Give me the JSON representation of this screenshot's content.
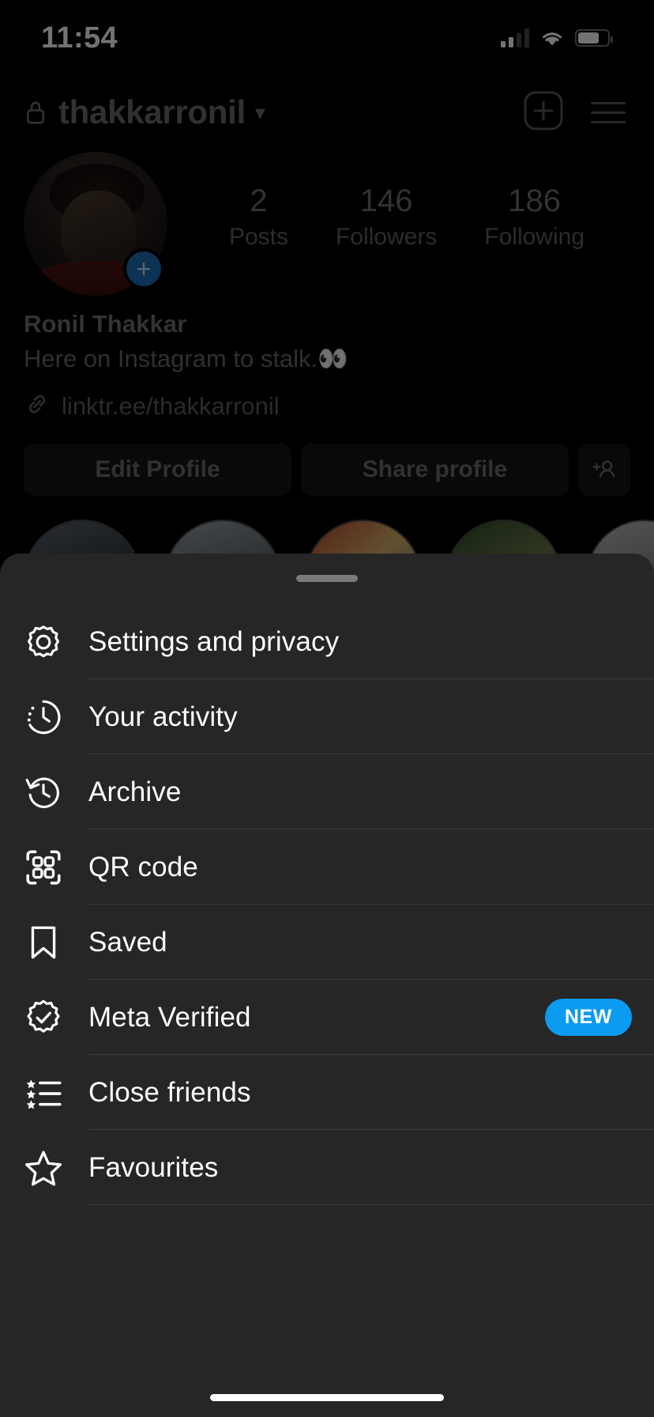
{
  "status_bar": {
    "time": "11:54",
    "signal_icon": "cellular-signal-icon",
    "wifi_icon": "wifi-icon",
    "battery_icon": "battery-icon"
  },
  "header": {
    "lock_icon": "lock-icon",
    "username": "thakkarronil",
    "chevron": "⌄",
    "add_icon": "add-post-icon",
    "menu_icon": "hamburger-menu-icon"
  },
  "profile": {
    "avatar_alt": "profile-avatar",
    "add_story_badge": "+",
    "stats": [
      {
        "value": "2",
        "label": "Posts"
      },
      {
        "value": "146",
        "label": "Followers"
      },
      {
        "value": "186",
        "label": "Following"
      }
    ],
    "display_name": "Ronil Thakkar",
    "bio": "Here on Instagram to stalk.👀",
    "link_icon": "link-chain-icon",
    "link_text": "linktr.ee/thakkarronil",
    "buttons": {
      "edit_profile": "Edit Profile",
      "share_profile": "Share profile",
      "add_person_icon": "add-person-icon"
    },
    "highlights_count": 5
  },
  "sheet": {
    "grabber": "drag-handle",
    "items": [
      {
        "icon": "gear-icon",
        "label": "Settings and privacy",
        "badge": ""
      },
      {
        "icon": "activity-clock-icon",
        "label": "Your activity",
        "badge": ""
      },
      {
        "icon": "archive-clock-icon",
        "label": "Archive",
        "badge": ""
      },
      {
        "icon": "qr-code-icon",
        "label": "QR code",
        "badge": ""
      },
      {
        "icon": "bookmark-icon",
        "label": "Saved",
        "badge": ""
      },
      {
        "icon": "verified-badge-icon",
        "label": "Meta Verified",
        "badge": "NEW"
      },
      {
        "icon": "close-friends-icon",
        "label": "Close friends",
        "badge": ""
      },
      {
        "icon": "star-icon",
        "label": "Favourites",
        "badge": ""
      }
    ]
  },
  "colors": {
    "accent_blue": "#0b9bf0",
    "sheet_bg": "#262626",
    "page_bg": "#000000",
    "divider": "#3a3a3a"
  },
  "home_indicator": "home-indicator"
}
